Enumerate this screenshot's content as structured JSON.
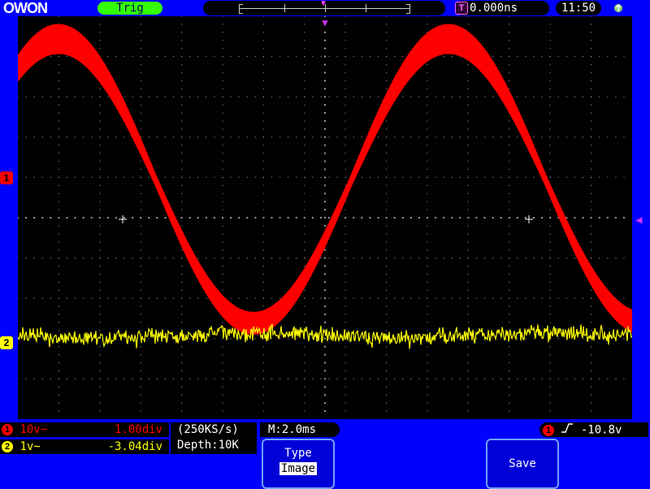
{
  "brand": "OWON",
  "status": {
    "trig_label": "Trig",
    "trigger_time": "0.000ns",
    "clock": "11:50",
    "trigger_badge": "T"
  },
  "channels": [
    {
      "num": "1",
      "coupling": "10v~",
      "offset": "1.00div",
      "color": "#ff0000"
    },
    {
      "num": "2",
      "coupling": "1v~",
      "offset": "-3.04div",
      "color": "#ffff00"
    }
  ],
  "acquisition": {
    "sample_rate": "(250KS/s)",
    "depth": "Depth:10K",
    "timebase": "M:2.0ms"
  },
  "trigger": {
    "source": "1",
    "level": "-10.8v"
  },
  "menu": {
    "type_label": "Type",
    "type_value": "Image",
    "save_label": "Save"
  },
  "colors": {
    "background": "#0000ff",
    "screen": "#000000",
    "ch1": "#ff0000",
    "ch2": "#ffff00",
    "trigger_marker": "#cc33ff"
  }
}
